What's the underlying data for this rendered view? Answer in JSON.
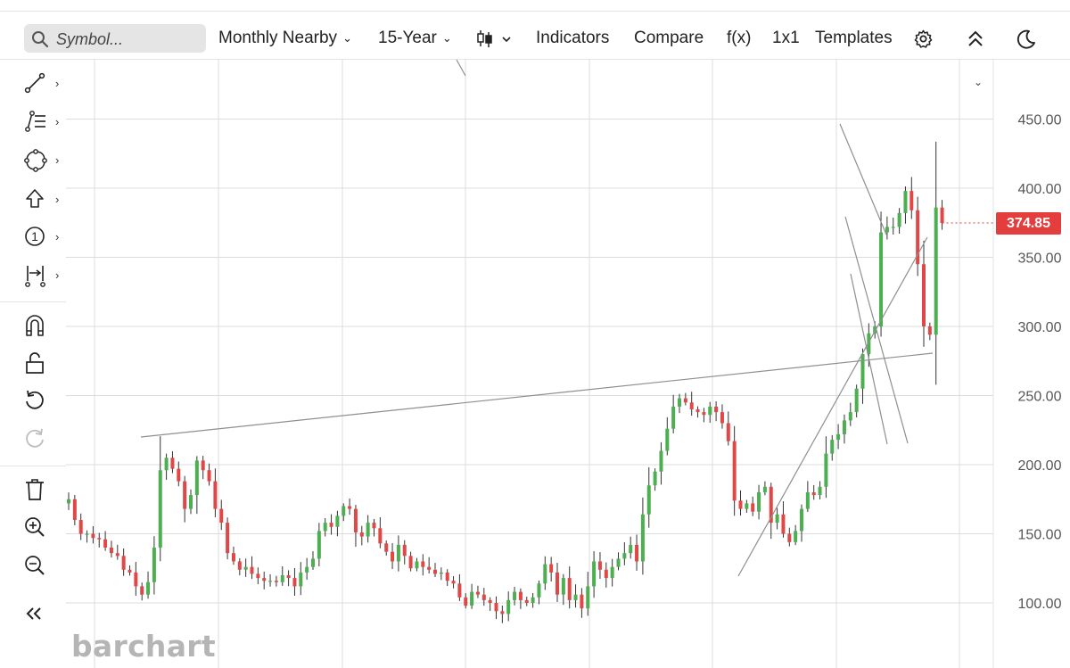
{
  "toolbar": {
    "search_placeholder": "Symbol...",
    "period_label": "Monthly Nearby",
    "range_label": "15-Year",
    "indicators_label": "Indicators",
    "compare_label": "Compare",
    "fx_label": "f(x)",
    "layout_label": "1x1",
    "templates_label": "Templates"
  },
  "icons": {
    "search": "search-icon",
    "chart_style": "candlestick-icon",
    "settings": "gear-icon",
    "collapse": "double-chevron-up-icon",
    "dark_mode": "moon-icon",
    "sidebar": [
      "trendline-icon",
      "fib-icon",
      "shapes-icon",
      "arrow-up-icon",
      "number-marker-icon",
      "measure-icon",
      "magnet-icon",
      "unlock-icon",
      "undo-icon",
      "redo-icon",
      "trash-icon",
      "zoom-in-icon",
      "zoom-out-icon",
      "double-chevron-left-icon"
    ]
  },
  "brand": {
    "logo_text": "barchart"
  },
  "colors": {
    "up": "#4caf50",
    "down": "#e04848",
    "price_badge": "#e33d3d",
    "grid": "#dcdcdc",
    "trendline": "#8f8f8f"
  },
  "chart_data": {
    "type": "candlestick",
    "interval": "monthly",
    "range": "15-Year",
    "ylim": [
      90,
      475
    ],
    "y_ticks": [
      "450.00",
      "400.00",
      "350.00",
      "300.00",
      "250.00",
      "200.00",
      "150.00",
      "100.00"
    ],
    "last_price": "374.85",
    "grid": true,
    "closes": [
      175,
      160,
      150,
      150,
      147,
      146,
      140,
      136,
      134,
      124,
      122,
      112,
      106,
      115,
      140,
      196,
      205,
      197,
      188,
      168,
      178,
      203,
      196,
      188,
      168,
      158,
      136,
      130,
      124,
      126,
      121,
      118,
      116,
      116,
      115,
      120,
      118,
      112,
      122,
      126,
      132,
      152,
      158,
      155,
      163,
      170,
      168,
      151,
      148,
      158,
      154,
      143,
      137,
      130,
      142,
      134,
      125,
      130,
      126,
      124,
      121,
      122,
      116,
      114,
      104,
      98,
      108,
      106,
      102,
      100,
      94,
      92,
      102,
      108,
      102,
      100,
      104,
      114,
      128,
      122,
      106,
      118,
      102,
      106,
      96,
      112,
      130,
      124,
      118,
      126,
      132,
      136,
      142,
      130,
      164,
      185,
      195,
      210,
      226,
      242,
      248,
      245,
      240,
      238,
      236,
      242,
      238,
      230,
      217,
      174,
      168,
      172,
      166,
      180,
      184,
      158,
      164,
      150,
      144,
      152,
      168,
      180,
      178,
      184,
      208,
      218,
      222,
      232,
      238,
      255,
      280,
      295,
      300,
      368,
      372,
      372,
      382,
      398,
      384,
      345,
      300,
      294,
      386,
      374.85
    ]
  }
}
